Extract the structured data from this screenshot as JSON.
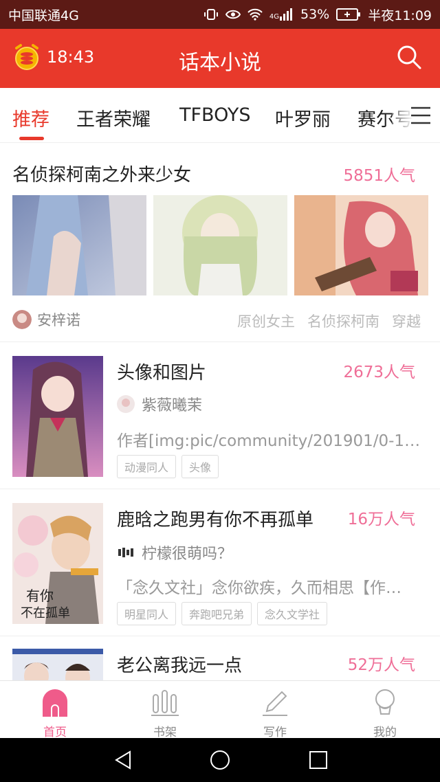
{
  "statusbar": {
    "carrier": "中国联通4G",
    "signal_label": "4G",
    "battery": "53%",
    "time": "半夜11:09"
  },
  "header": {
    "timer": "18:43",
    "title": "话本小说"
  },
  "tabs": [
    "推荐",
    "王者荣耀",
    "TFBOYS",
    "叶罗丽",
    "赛尔号"
  ],
  "featured": {
    "title": "名侦探柯南之外来少女",
    "popularity": "5851人气",
    "author": "安梓诺",
    "tags": [
      "原创女主",
      "名侦探柯南",
      "穿越"
    ]
  },
  "stories": [
    {
      "title": "头像和图片",
      "popularity": "2673人气",
      "author": "紫薇曦茉",
      "desc": "作者[img:pic/community/201901/0-1548…",
      "tags": [
        "动漫同人",
        "头像"
      ]
    },
    {
      "title": "鹿晗之跑男有你不再孤单",
      "popularity": "16万人气",
      "author": "柠檬很萌吗？",
      "desc": "「念久文社」念你欲疾，久而相思【作…",
      "tags": [
        "明星同人",
        "奔跑吧兄弟",
        "念久文学社"
      ],
      "cover_text": "有你不在孤单"
    },
    {
      "title": "老公离我远一点",
      "popularity": "52万人气"
    }
  ],
  "nav": [
    {
      "label": "首页",
      "icon": "home-icon"
    },
    {
      "label": "书架",
      "icon": "bookshelf-icon"
    },
    {
      "label": "写作",
      "icon": "pencil-icon"
    },
    {
      "label": "我的",
      "icon": "profile-icon"
    }
  ],
  "colors": {
    "header_red": "#e8392b",
    "statusbar": "#5c1a15",
    "popularity_pink": "#ef6e97",
    "tab_active": "#e8392b"
  }
}
